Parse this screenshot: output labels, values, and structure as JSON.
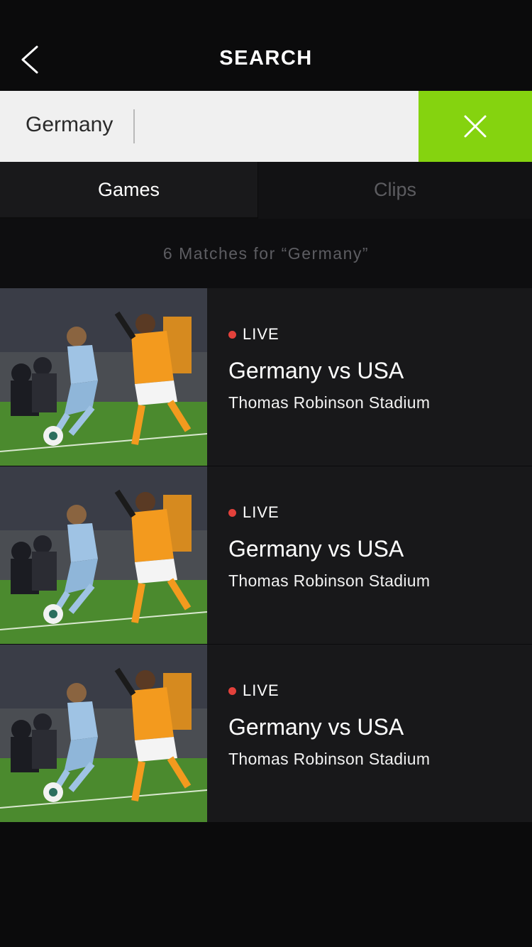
{
  "header": {
    "title": "SEARCH",
    "back_icon": "chevron-left-icon"
  },
  "search": {
    "value": "Germany",
    "clear_icon": "close-icon"
  },
  "colors": {
    "accent": "#85d30f",
    "live_dot": "#e3413b",
    "background": "#0b0b0c",
    "card": "#18181a"
  },
  "tabs": [
    {
      "label": "Games",
      "selected": true
    },
    {
      "label": "Clips",
      "selected": false
    }
  ],
  "results": {
    "count_text": "6 Matches for “Germany”",
    "items": [
      {
        "status": "LIVE",
        "title": "Germany vs USA",
        "venue": "Thomas Robinson Stadium"
      },
      {
        "status": "LIVE",
        "title": "Germany vs USA",
        "venue": "Thomas Robinson Stadium"
      },
      {
        "status": "LIVE",
        "title": "Germany vs USA",
        "venue": "Thomas Robinson Stadium"
      }
    ]
  }
}
